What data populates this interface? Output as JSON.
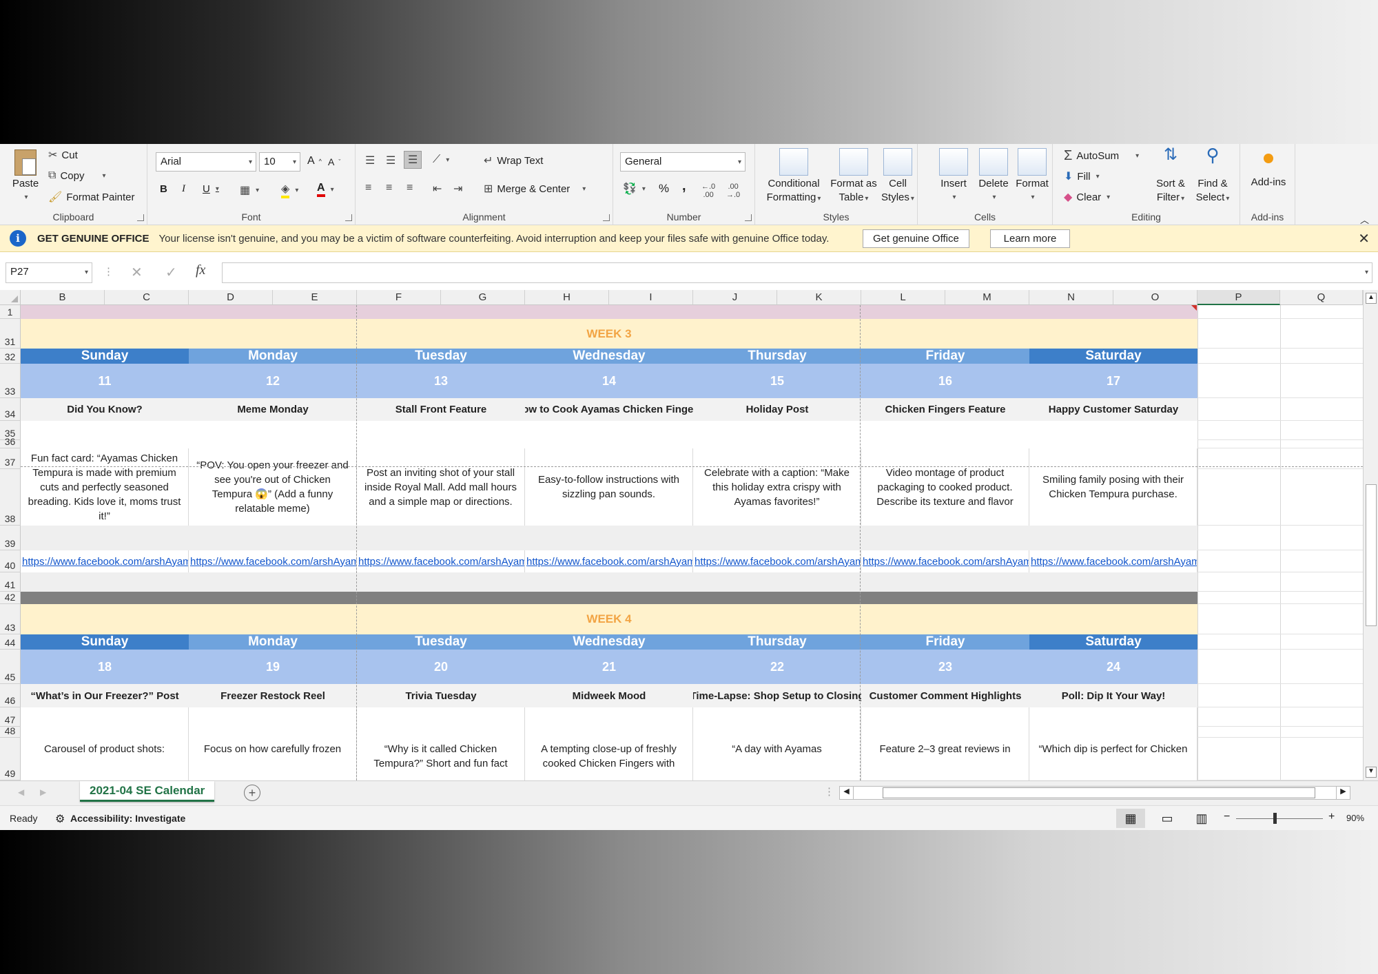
{
  "ribbon": {
    "clipboard": {
      "label": "Clipboard",
      "paste": "Paste",
      "cut": "Cut",
      "copy": "Copy",
      "format_painter": "Format Painter"
    },
    "font": {
      "label": "Font",
      "name": "Arial",
      "size": "10",
      "bold": "B",
      "italic": "I",
      "underline": "U"
    },
    "alignment": {
      "label": "Alignment",
      "wrap": "Wrap Text",
      "merge": "Merge & Center"
    },
    "number": {
      "label": "Number",
      "format": "General",
      "percent": "%",
      "comma": ","
    },
    "styles": {
      "label": "Styles",
      "conditional": [
        "Conditional",
        "Formatting"
      ],
      "format_table": [
        "Format as",
        "Table"
      ],
      "cell_styles": [
        "Cell",
        "Styles"
      ]
    },
    "cells": {
      "label": "Cells",
      "insert": "Insert",
      "delete": "Delete",
      "format": "Format"
    },
    "editing": {
      "label": "Editing",
      "autosum": "AutoSum",
      "fill": "Fill",
      "clear": "Clear",
      "sort": [
        "Sort &",
        "Filter"
      ],
      "find": [
        "Find &",
        "Select"
      ]
    },
    "addins": {
      "label": "Add-ins",
      "addins": "Add-ins"
    }
  },
  "message_bar": {
    "title": "GET GENUINE OFFICE",
    "text": "Your license isn't genuine, and you may be a victim of software counterfeiting. Avoid interruption and keep your files safe with genuine Office today.",
    "button1": "Get genuine Office",
    "button2": "Learn more"
  },
  "formula_bar": {
    "name_box": "P27",
    "value": ""
  },
  "columns": [
    "B",
    "C",
    "D",
    "E",
    "F",
    "G",
    "H",
    "I",
    "J",
    "K",
    "L",
    "M",
    "N",
    "O",
    "P",
    "Q"
  ],
  "rows": {
    "r1": "1",
    "r31": "31",
    "r32": "32",
    "r33": "33",
    "r34": "34",
    "r35": "35",
    "r36": "36",
    "r37": "37",
    "r38": "38",
    "r39": "39",
    "r40": "40",
    "r41": "41",
    "r42": "42",
    "r43": "43",
    "r44": "44",
    "r45": "45",
    "r46": "46",
    "r47": "47",
    "r48": "48",
    "r49": "49"
  },
  "days": [
    "Sunday",
    "Monday",
    "Tuesday",
    "Wednesday",
    "Thursday",
    "Friday",
    "Saturday"
  ],
  "week3": {
    "label": "WEEK 3",
    "dates": [
      "11",
      "12",
      "13",
      "14",
      "15",
      "16",
      "17"
    ],
    "topics": [
      "Did You Know?",
      "Meme Monday",
      "Stall Front Feature",
      "How to Cook Ayamas Chicken Fingers",
      "Holiday Post",
      "Chicken Fingers Feature",
      "Happy Customer Saturday"
    ],
    "descriptions": [
      "Fun fact card: “Ayamas Chicken Tempura is made with premium cuts and perfectly seasoned breading. Kids love it, moms trust it!”",
      "“POV: You open your freezer and see you're out of Chicken Tempura 😱” (Add a funny relatable meme)",
      "Post an inviting shot of your stall inside Royal Mall. Add mall hours and a simple map or directions.",
      "Easy-to-follow instructions with sizzling pan sounds.",
      "Celebrate with a caption: “Make this holiday extra crispy with Ayamas favorites!”",
      "Video montage of product packaging to cooked product. Describe its texture and flavor",
      "Smiling family posing with their Chicken Tempura purchase."
    ],
    "links": [
      "https://www.facebook.com/arshAyamas",
      "https://www.facebook.com/arshAyamas",
      "https://www.facebook.com/arshAyamas",
      "https://www.facebook.com/arshAyamas",
      "https://www.facebook.com/arshAyamas",
      "https://www.facebook.com/arshAyamas",
      "https://www.facebook.com/arshAyamas"
    ]
  },
  "week4": {
    "label": "WEEK 4",
    "dates": [
      "18",
      "19",
      "20",
      "21",
      "22",
      "23",
      "24"
    ],
    "topics": [
      "“What’s in Our Freezer?” Post",
      "Freezer Restock Reel",
      "Trivia Tuesday",
      "Midweek Mood",
      "Time-Lapse: Shop Setup to Closing",
      "Customer Comment Highlights",
      "Poll: Dip It Your Way!"
    ],
    "descriptions": [
      "Carousel of product shots:",
      "Focus on how carefully frozen",
      "“Why is it called Chicken Tempura?” Short and fun fact",
      "A tempting close-up of freshly cooked Chicken Fingers with",
      "“A day with Ayamas",
      "Feature 2–3 great reviews in",
      "“Which dip is perfect for Chicken"
    ]
  },
  "sheet_tab": "2021-04 SE Calendar",
  "status": {
    "ready": "Ready",
    "accessibility": "Accessibility: Investigate",
    "zoom": "90%"
  },
  "colors": {
    "sunday": "#3d7fc9",
    "weekday": "#6fa3dd",
    "date_band": "#a8c3ee",
    "week_band": "#fff2cc",
    "week_text": "#f2a444",
    "header_pink": "#e6cfdc",
    "divider": "#808080",
    "topic_band": "#f2f2f2",
    "desc_band": "#efefef"
  }
}
